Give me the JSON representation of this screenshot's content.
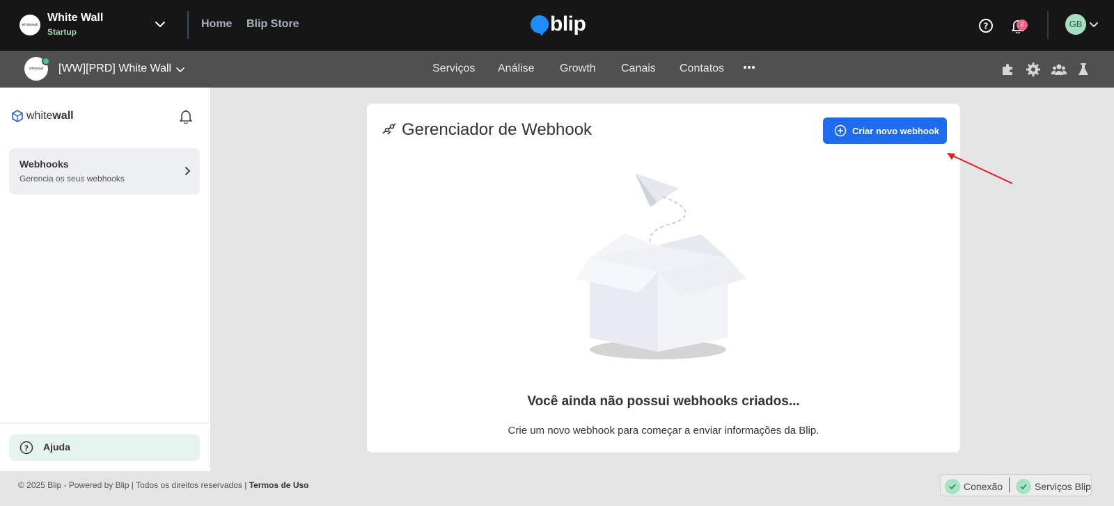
{
  "topbar": {
    "tenant_name": "White Wall",
    "tenant_plan": "Startup",
    "tenant_logo_text": "whitewall",
    "links": [
      "Home",
      "Blip Store"
    ],
    "brand": "blip",
    "notification_count": "2",
    "avatar_initials": "GB"
  },
  "subbar": {
    "bot_name": "[WW][PRD] White Wall",
    "bot_logo_text": "whitewall",
    "nav": [
      "Serviços",
      "Análise",
      "Growth",
      "Canais",
      "Contatos"
    ]
  },
  "sidebar": {
    "logo_light": "white",
    "logo_bold": "wall",
    "item": {
      "title": "Webhooks",
      "subtitle": "Gerencia os seus webhooks"
    },
    "help_label": "Ajuda"
  },
  "card": {
    "title": "Gerenciador de Webhook",
    "create_button": "Criar novo webhook",
    "empty_title": "Você ainda não possui webhooks criados...",
    "empty_subtitle": "Crie um novo webhook para começar a enviar informações da Blip."
  },
  "footer": {
    "copyright": "© 2025 Blip - Powered by Blip | Todos os direitos reservados | ",
    "terms": "Termos de Uso",
    "status": [
      "Conexão",
      "Serviços Blip"
    ]
  },
  "colors": {
    "topbar": "#161616",
    "subbar": "#505050",
    "primary_button": "#1d6cf0",
    "brand_blue": "#1e8cff",
    "status_ok": "#a6e3c2",
    "annotation_arrow": "#e0201a"
  }
}
